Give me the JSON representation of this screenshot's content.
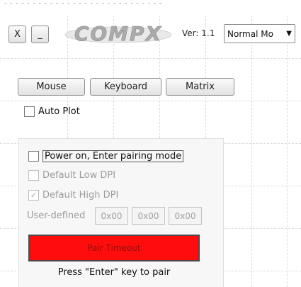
{
  "top_cut_text": "- - - - - - - - - - - - - - - - - - - - - - - - - - - -",
  "titlebar": {
    "close_label": "X",
    "minimize_label": "_",
    "logo_text": "COMPX",
    "version_label": "Ver: 1.1",
    "mode_select_value": "Normal Mo"
  },
  "tabs": {
    "mouse": "Mouse",
    "keyboard": "Keyboard",
    "matrix": "Matrix"
  },
  "auto_plot_label": "Auto Plot",
  "pairing": {
    "power_on_label": "Power on, Enter pairing mode",
    "default_low_dpi_label": "Default Low DPI",
    "default_high_dpi_label": "Default High DPI",
    "user_defined_label": "User-defined",
    "user_defined_values": [
      "0x00",
      "0x00",
      "0x00"
    ],
    "pair_button_label": "Pair Timeout",
    "hint_text": "Press \"Enter\" key to pair"
  },
  "colors": {
    "pair_button": "#ff0d0d",
    "logo": "#b3b3b3"
  }
}
